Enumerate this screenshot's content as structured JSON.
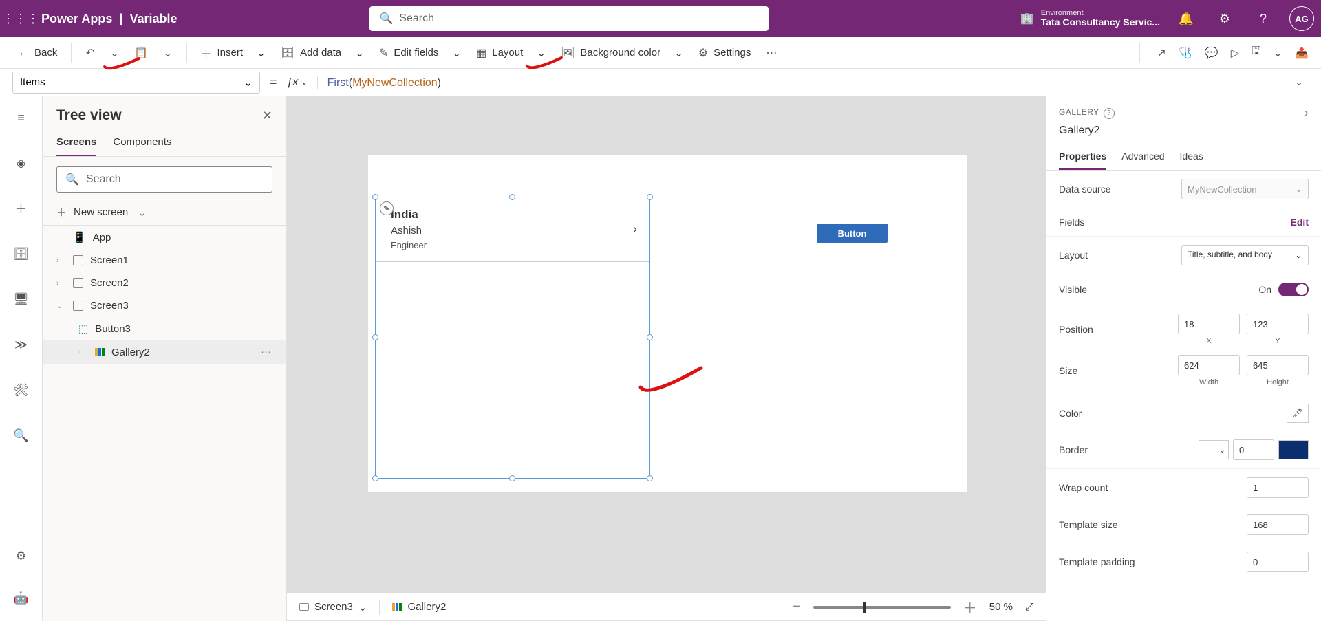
{
  "header": {
    "app": "Power Apps",
    "sep": "|",
    "doc": "Variable",
    "search_placeholder": "Search",
    "env_label": "Environment",
    "env_name": "Tata Consultancy Servic...",
    "avatar": "AG"
  },
  "toolbar": {
    "back": "Back",
    "insert": "Insert",
    "add_data": "Add data",
    "edit_fields": "Edit fields",
    "layout": "Layout",
    "bg_color": "Background color",
    "settings": "Settings"
  },
  "formula": {
    "property": "Items",
    "fn": "First",
    "open": "(",
    "coll": "MyNewCollection",
    "close": ")"
  },
  "tree": {
    "title": "Tree view",
    "tab_screens": "Screens",
    "tab_components": "Components",
    "search_placeholder": "Search",
    "new_screen": "New screen",
    "app": "App",
    "screen1": "Screen1",
    "screen2": "Screen2",
    "screen3": "Screen3",
    "button3": "Button3",
    "gallery2": "Gallery2"
  },
  "canvas": {
    "title": "India",
    "subtitle": "Ashish",
    "body": "Engineer",
    "button_label": "Button"
  },
  "statusbar": {
    "screen": "Screen3",
    "gallery": "Gallery2",
    "zoom_pct": "50",
    "pct_sym": "%"
  },
  "rp": {
    "category": "GALLERY",
    "name": "Gallery2",
    "tab_props": "Properties",
    "tab_adv": "Advanced",
    "tab_ideas": "Ideas",
    "datasource_label": "Data source",
    "datasource_val": "MyNewCollection",
    "fields_label": "Fields",
    "fields_edit": "Edit",
    "layout_label": "Layout",
    "layout_val": "Title, subtitle, and body",
    "visible_label": "Visible",
    "visible_on": "On",
    "position_label": "Position",
    "pos_x": "18",
    "pos_x_l": "X",
    "pos_y": "123",
    "pos_y_l": "Y",
    "size_label": "Size",
    "width": "624",
    "width_l": "Width",
    "height": "645",
    "height_l": "Height",
    "color_label": "Color",
    "border_label": "Border",
    "border_val": "0",
    "wrap_label": "Wrap count",
    "wrap_val": "1",
    "tmpl_size_label": "Template size",
    "tmpl_size_val": "168",
    "tmpl_pad_label": "Template padding",
    "tmpl_pad_val": "0"
  }
}
